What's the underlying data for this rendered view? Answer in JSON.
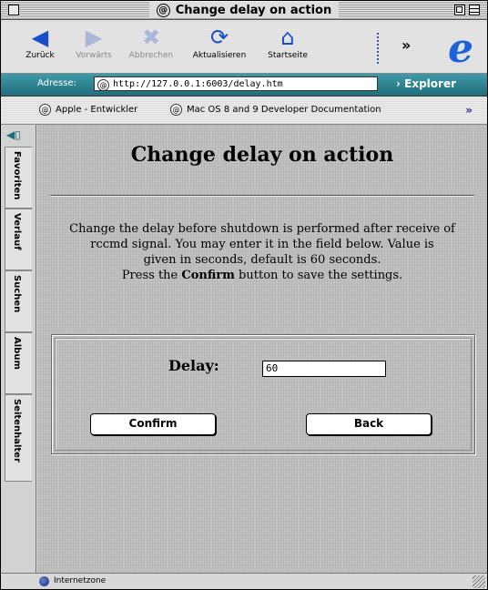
{
  "window": {
    "title": "Change delay on action"
  },
  "toolbar": {
    "buttons": [
      {
        "label": "Zurück",
        "icon": "back-arrow-icon",
        "enabled": true
      },
      {
        "label": "Vorwärts",
        "icon": "forward-arrow-icon",
        "enabled": false
      },
      {
        "label": "Abbrechen",
        "icon": "stop-x-icon",
        "enabled": false
      },
      {
        "label": "Aktualisieren",
        "icon": "refresh-icon",
        "enabled": true
      },
      {
        "label": "Startseite",
        "icon": "home-icon",
        "enabled": true
      }
    ],
    "more": "»"
  },
  "address": {
    "label": "Adresse:",
    "url": "http://127.0.0.1:6003/delay.htm",
    "explorer_tab": "Explorer"
  },
  "favorites": {
    "items": [
      {
        "label": "Apple - Entwickler"
      },
      {
        "label": "Mac OS 8 and 9 Developer Documentation"
      }
    ],
    "more": "»"
  },
  "sidebar": {
    "tabs": [
      "Favoriten",
      "Verlauf",
      "Suchen",
      "Album",
      "Seitenhalter"
    ]
  },
  "page": {
    "title": "Change delay on action",
    "desc_line1": "Change the delay before shutdown is performed after receive of",
    "desc_line2": "rccmd signal. You may enter it in the field below. Value is",
    "desc_line3": "given in seconds, default is 60 seconds.",
    "desc_line4_prefix": "Press the",
    "desc_line4_bold": "Confirm",
    "desc_line4_suffix": "button to save the settings.",
    "delay_label": "Delay:",
    "delay_value": "60",
    "confirm_label": "Confirm",
    "back_label": "Back"
  },
  "status": {
    "zone": "Internetzone"
  },
  "colors": {
    "address_bar": "#2f8593",
    "ie_logo": "#1a63d8"
  }
}
